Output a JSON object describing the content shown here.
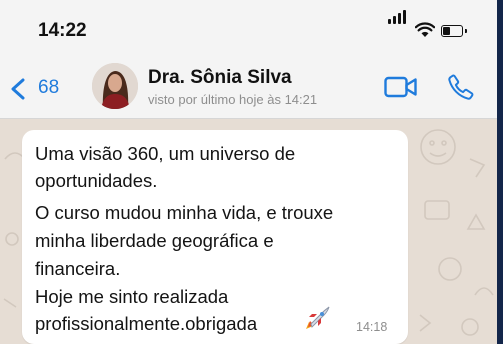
{
  "status_bar": {
    "time": "14:22",
    "icons": [
      "signal-icon",
      "wifi-icon",
      "battery-icon"
    ]
  },
  "header": {
    "back_count": "68",
    "contact_name": "Dra. Sônia Silva",
    "last_seen": "visto por último hoje às 14:21",
    "actions": [
      "video-call-icon",
      "phone-call-icon"
    ]
  },
  "message": {
    "lines": [
      "Uma visão 360, um universo de",
      "oportunidades.",
      "O curso mudou minha vida, e trouxe",
      "minha liberdade geográfica e",
      "financeira.",
      "Hoje me sinto realizada",
      "profissionalmente.obrigada"
    ],
    "emoji": "rocket-emoji",
    "time": "14:18"
  },
  "colors": {
    "accent": "#1f7bdc",
    "chat_background": "#e6ddd4",
    "header_background": "#f4f4f4",
    "bubble": "#ffffff"
  }
}
